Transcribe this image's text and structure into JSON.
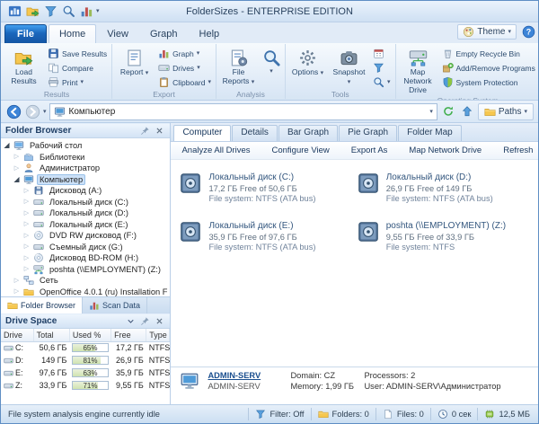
{
  "window": {
    "title": "FolderSizes - ENTERPRISE EDITION"
  },
  "titlebar": {
    "quick_access": [
      "app",
      "load",
      "funnel",
      "magnifier",
      "chart"
    ]
  },
  "ribbon": {
    "file_tab": "File",
    "theme_label": "Theme",
    "tabs": [
      {
        "label": "Home",
        "active": true
      },
      {
        "label": "View",
        "active": false
      },
      {
        "label": "Graph",
        "active": false
      },
      {
        "label": "Help",
        "active": false
      }
    ],
    "groups": [
      {
        "label": "Results",
        "big": [
          {
            "label": "Load Results",
            "icon": "load",
            "arrow": false
          }
        ],
        "small": [
          {
            "label": "Save Results",
            "icon": "save",
            "arrow": false
          },
          {
            "label": "Compare",
            "icon": "compare",
            "arrow": false
          },
          {
            "label": "Print",
            "icon": "print",
            "arrow": true
          }
        ]
      },
      {
        "label": "Export",
        "big": [
          {
            "label": "Report",
            "icon": "report",
            "arrow": true
          }
        ],
        "small": [
          {
            "label": "Graph",
            "icon": "chart",
            "arrow": true
          },
          {
            "label": "Drives",
            "icon": "drive",
            "arrow": true
          },
          {
            "label": "Clipboard",
            "icon": "clipboard",
            "arrow": true
          }
        ]
      },
      {
        "label": "Analysis",
        "big": [
          {
            "label": "File Reports",
            "icon": "filereports",
            "arrow": true
          },
          {
            "label": "",
            "name": "search",
            "icon": "magnifier",
            "arrow": true
          }
        ]
      },
      {
        "label": "Tools",
        "big": [
          {
            "label": "Options",
            "icon": "gear",
            "arrow": true
          },
          {
            "label": "Snapshot",
            "icon": "camera",
            "arrow": true
          }
        ],
        "smallicons": [
          {
            "name": "scheduler",
            "icon": "scheduler",
            "arrow": false
          },
          {
            "name": "filter-tool",
            "icon": "funnel",
            "arrow": false
          },
          {
            "name": "search-tool",
            "icon": "magnifier",
            "arrow": true
          }
        ]
      },
      {
        "label": "Operating System",
        "big": [
          {
            "label": "Map Network Drive",
            "icon": "networkdrive",
            "arrow": false
          }
        ],
        "small": [
          {
            "label": "Empty Recycle Bin",
            "icon": "bin",
            "arrow": false
          },
          {
            "label": "Add/Remove Programs",
            "icon": "addremove",
            "arrow": false
          },
          {
            "label": "System Protection",
            "icon": "shield",
            "arrow": false
          }
        ]
      }
    ]
  },
  "address": {
    "value": "Компьютер",
    "paths_label": "Paths"
  },
  "sidebar": {
    "folder_browser_title": "Folder Browser",
    "tabs": [
      {
        "label": "Folder Browser",
        "icon": "folder",
        "active": true
      },
      {
        "label": "Scan Data",
        "icon": "chart",
        "active": false
      }
    ],
    "tree": [
      {
        "label": "Рабочий стол",
        "level": 0,
        "icon": "desktop",
        "expand": "open",
        "selected": false
      },
      {
        "label": "Библиотеки",
        "level": 1,
        "icon": "libraries",
        "expand": "closed",
        "selected": false
      },
      {
        "label": "Администратор",
        "level": 1,
        "icon": "user",
        "expand": "closed",
        "selected": false
      },
      {
        "label": "Компьютер",
        "level": 1,
        "icon": "computer",
        "expand": "open",
        "selected": true
      },
      {
        "label": "Дисковод (A:)",
        "level": 2,
        "icon": "floppy",
        "expand": "closed",
        "selected": false
      },
      {
        "label": "Локальный диск (C:)",
        "level": 2,
        "icon": "drive",
        "expand": "closed",
        "selected": false
      },
      {
        "label": "Локальный диск (D:)",
        "level": 2,
        "icon": "drive",
        "expand": "closed",
        "selected": false
      },
      {
        "label": "Локальный диск (E:)",
        "level": 2,
        "icon": "drive",
        "expand": "closed",
        "selected": false
      },
      {
        "label": "DVD RW дисковод (F:)",
        "level": 2,
        "icon": "cd",
        "expand": "closed",
        "selected": false
      },
      {
        "label": "Съемный диск (G:)",
        "level": 2,
        "icon": "drive",
        "expand": "closed",
        "selected": false
      },
      {
        "label": "Дисковод BD-ROM (H:)",
        "level": 2,
        "icon": "cd",
        "expand": "closed",
        "selected": false
      },
      {
        "label": "poshta (\\\\EMPLOYMENT) (Z:)",
        "level": 2,
        "icon": "networkdrive",
        "expand": "closed",
        "selected": false
      },
      {
        "label": "Сеть",
        "level": 1,
        "icon": "network",
        "expand": "closed",
        "selected": false
      },
      {
        "label": "OpenOffice 4.0.1 (ru) Installation F",
        "level": 1,
        "icon": "folder",
        "expand": "closed",
        "selected": false
      }
    ]
  },
  "drive_space": {
    "title": "Drive Space",
    "columns": [
      "Drive",
      "Total",
      "Used %",
      "Free",
      "Type"
    ],
    "rows": [
      {
        "drive": "C:",
        "total": "50,6 ГБ",
        "used": 65,
        "free": "17,2 ГБ",
        "type": "NTFS"
      },
      {
        "drive": "D:",
        "total": "149 ГБ",
        "used": 81,
        "free": "26,9 ГБ",
        "type": "NTFS"
      },
      {
        "drive": "E:",
        "total": "97,6 ГБ",
        "used": 63,
        "free": "35,9 ГБ",
        "type": "NTFS"
      },
      {
        "drive": "Z:",
        "total": "33,9 ГБ",
        "used": 71,
        "free": "9,55 ГБ",
        "type": "NTFS"
      }
    ]
  },
  "main": {
    "tabs": [
      {
        "label": "Computer",
        "active": true
      },
      {
        "label": "Details",
        "active": false
      },
      {
        "label": "Bar Graph",
        "active": false
      },
      {
        "label": "Pie Graph",
        "active": false
      },
      {
        "label": "Folder Map",
        "active": false
      }
    ],
    "toolbar": [
      "Analyze All Drives",
      "Configure View",
      "Export As",
      "Map Network Drive",
      "Refresh"
    ],
    "drives": [
      {
        "name": "Локальный диск (C:)",
        "free": "17,2 ГБ Free of 50,6 ГБ",
        "fs": "File system: NTFS (ATA bus)"
      },
      {
        "name": "Локальный диск (D:)",
        "free": "26,9 ГБ Free of 149 ГБ",
        "fs": "File system: NTFS (ATA bus)"
      },
      {
        "name": "Локальный диск (E:)",
        "free": "35,9 ГБ Free of 97,6 ГБ",
        "fs": "File system: NTFS (ATA bus)"
      },
      {
        "name": "poshta (\\\\EMPLOYMENT) (Z:)",
        "free": "9,55 ГБ Free of 33,9 ГБ",
        "fs": "File system: NTFS"
      }
    ],
    "computer_info": {
      "name_link": "ADMIN-SERV",
      "name_sub": "ADMIN-SERV",
      "domain": "Domain: CZ",
      "processors": "Processors: 2",
      "memory": "Memory: 1,99 ГБ",
      "user": "User: ADMIN-SERV\\Администратор"
    }
  },
  "statusbar": {
    "left": "File system analysis engine currently idle",
    "segments": [
      {
        "name": "filter",
        "icon": "funnel",
        "text": "Filter: Off"
      },
      {
        "name": "folders",
        "icon": "folder",
        "text": "Folders: 0"
      },
      {
        "name": "files",
        "icon": "file",
        "text": "Files: 0"
      },
      {
        "name": "elapsed",
        "icon": "clock",
        "text": "0 сек"
      },
      {
        "name": "memory",
        "icon": "memory",
        "text": "12,5 МБ"
      }
    ]
  },
  "colors": {
    "accent_blue": "#1a66bc",
    "selection": "#cbe0f7",
    "ribbon_bg": "#e3edf8",
    "status_green": "#43b050"
  }
}
